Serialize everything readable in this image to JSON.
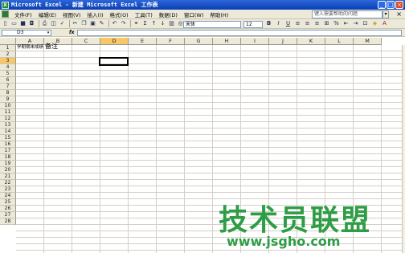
{
  "window": {
    "title": "Microsoft Excel - 新建 Microsoft Excel 工作表",
    "app_icon": "excel-icon",
    "buttons": [
      "minimize",
      "maximize",
      "close"
    ]
  },
  "menu": {
    "items": [
      "文件(F)",
      "编辑(E)",
      "视图(V)",
      "插入(I)",
      "格式(O)",
      "工具(T)",
      "数据(D)",
      "窗口(W)",
      "帮助(H)"
    ],
    "help_placeholder": "键入需要帮助的问题",
    "close_glyph": "×"
  },
  "toolbar": {
    "font_name": "宋体",
    "font_size": "12",
    "format_buttons": [
      "B",
      "I",
      "U"
    ]
  },
  "formula_bar": {
    "name_box": "D3",
    "fx_label": "fx",
    "content": ""
  },
  "grid": {
    "columns": [
      "A",
      "B",
      "C",
      "D",
      "E",
      "F",
      "G",
      "H",
      "I",
      "J",
      "K",
      "L",
      "M"
    ],
    "active_column": "D",
    "rows": [
      "1",
      "2",
      "3",
      "4",
      "5",
      "6",
      "7",
      "8",
      "9",
      "10",
      "11",
      "12",
      "13",
      "14",
      "15",
      "16",
      "17",
      "18",
      "19",
      "20",
      "21",
      "22",
      "23",
      "24",
      "25",
      "26",
      "27",
      "28"
    ],
    "active_row": "3",
    "cells": {
      "A1": "学期期末成绩",
      "B1": "备注"
    }
  },
  "watermark": {
    "title": "技术员联盟",
    "url": "www.jsgho.com"
  },
  "colors": {
    "titlebar": "#0a3fb4",
    "active_header": "#f8c768",
    "watermark": "#2e9d46"
  }
}
